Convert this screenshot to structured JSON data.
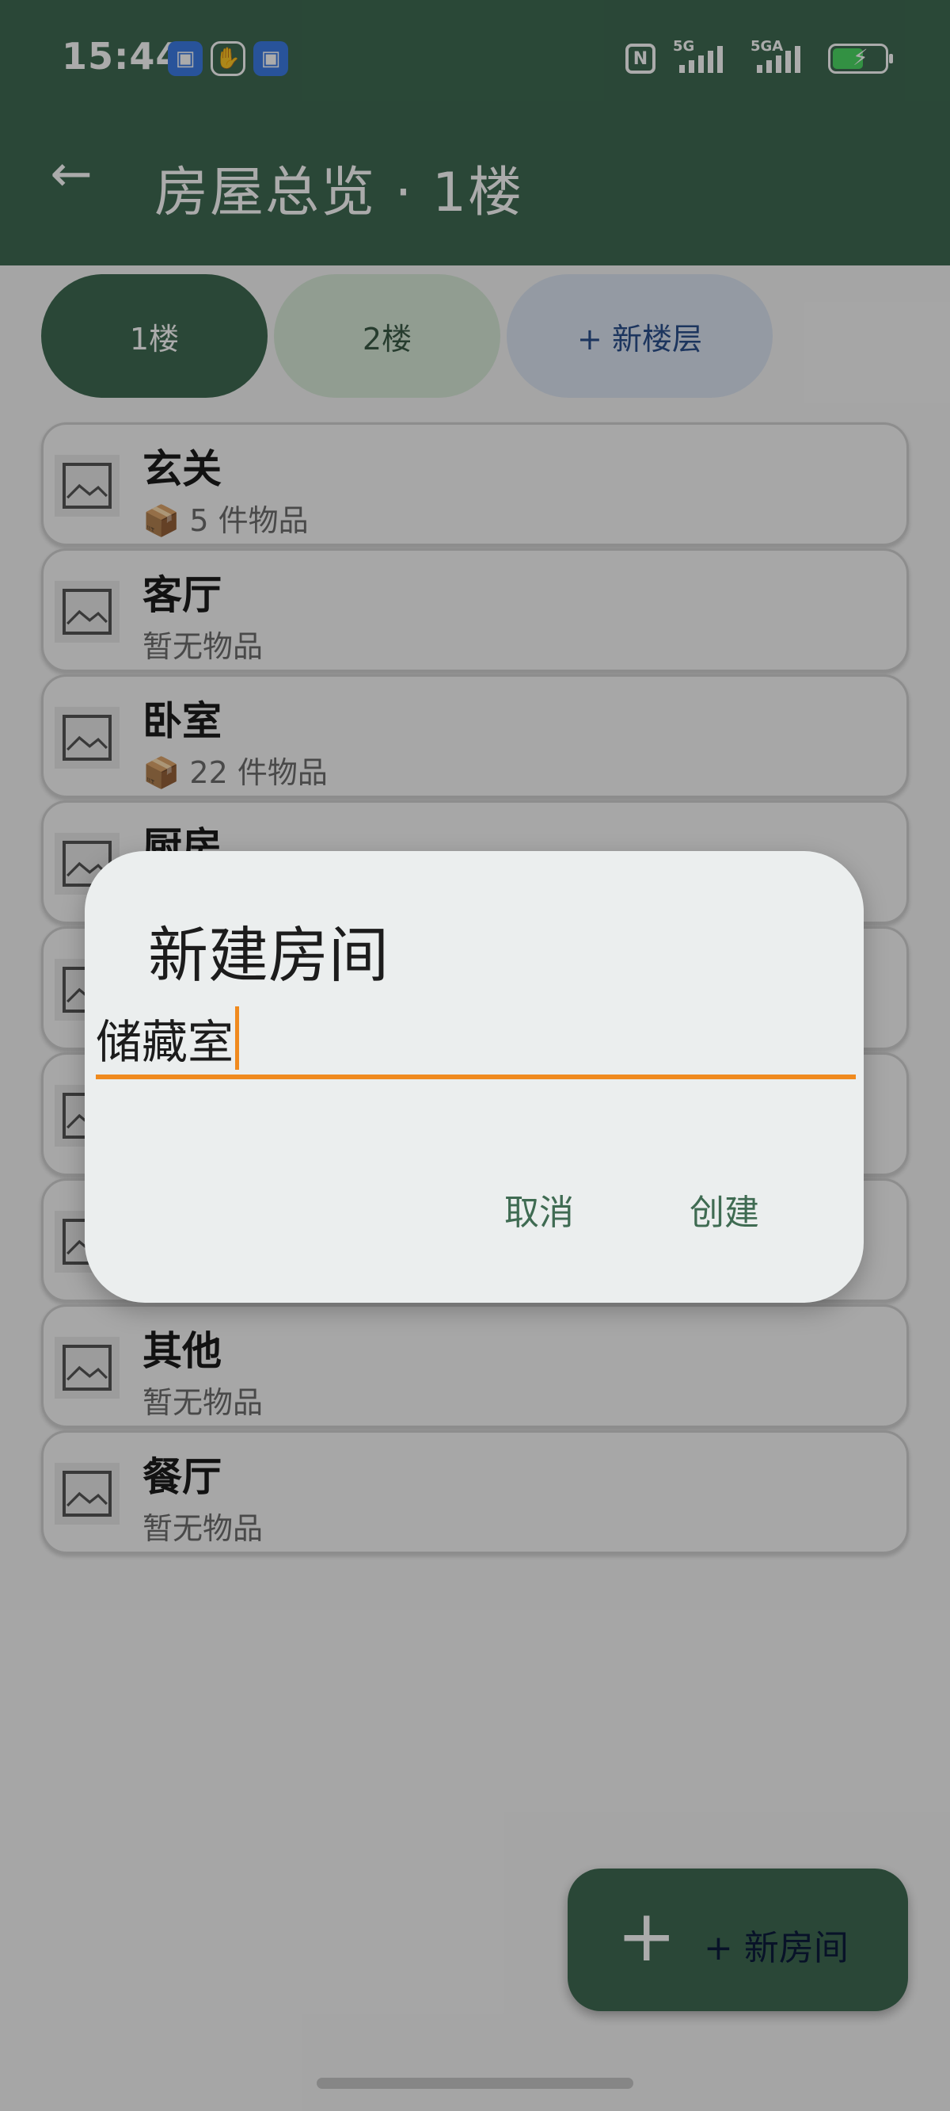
{
  "status_bar": {
    "time": "15:44",
    "signal_1_label": "5G",
    "signal_2_label": "5GA",
    "colors": {
      "background": "#3f6b52",
      "battery_fill": "#4cd964"
    },
    "icons": [
      "app-notification-icon",
      "hand-icon",
      "app-notification-icon",
      "nfc-icon",
      "signal-icon",
      "signal-icon",
      "battery-charging-icon"
    ]
  },
  "app_bar": {
    "title": "房屋总览 · 1楼",
    "back_icon": "arrow-left-icon"
  },
  "floor_tabs": [
    {
      "label": "1楼",
      "selected": true
    },
    {
      "label": "2楼",
      "selected": false
    },
    {
      "label": "+ 新楼层",
      "selected": false
    }
  ],
  "rooms": [
    {
      "name": "玄关",
      "count": "📦 5 件物品"
    },
    {
      "name": "客厅",
      "count": "暂无物品"
    },
    {
      "name": "卧室",
      "count": "📦 22 件物品"
    },
    {
      "name": "厨房",
      "count": ""
    },
    {
      "name": "",
      "count": ""
    },
    {
      "name": "",
      "count": ""
    },
    {
      "name": "",
      "count": ""
    },
    {
      "name": "其他",
      "count": "暂无物品"
    },
    {
      "name": "餐厅",
      "count": "暂无物品"
    }
  ],
  "fab": {
    "icon": "plus-icon",
    "label": "+ 新房间"
  },
  "dialog": {
    "title": "新建房间",
    "input_value": "储藏室",
    "cancel_label": "取消",
    "create_label": "创建",
    "accent_color": "#f08a1e",
    "button_color": "#3f6b52"
  }
}
